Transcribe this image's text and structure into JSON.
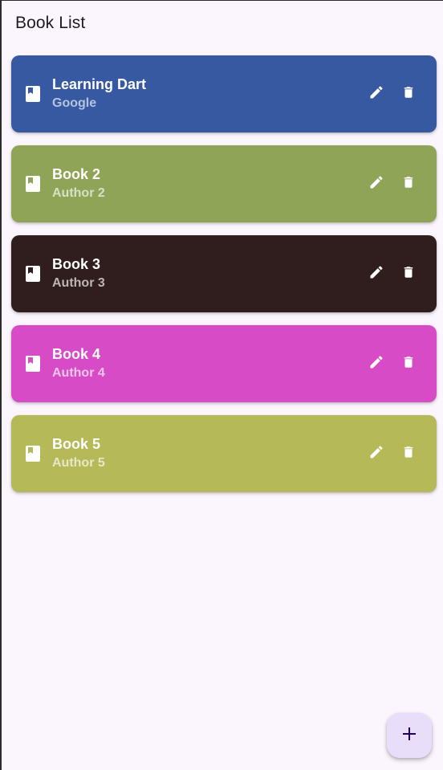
{
  "app_bar": {
    "title": "Book List"
  },
  "books": [
    {
      "title": "Learning Dart",
      "author": "Google",
      "color": "#3759a2",
      "author_color": "#b6c3e0"
    },
    {
      "title": "Book 2",
      "author": "Author 2",
      "color": "#8fa456",
      "author_color": "#d8e0c4"
    },
    {
      "title": "Book 3",
      "author": "Author 3",
      "color": "#301e1e",
      "author_color": "#bcb6b6"
    },
    {
      "title": "Book 4",
      "author": "Author 4",
      "color": "#d74cc6",
      "author_color": "#f1c5ec"
    },
    {
      "title": "Book 5",
      "author": "Author 5",
      "color": "#b5b957",
      "author_color": "#e6e8c6"
    }
  ],
  "icons": {
    "book": "book-icon",
    "edit": "edit-icon",
    "delete": "delete-icon",
    "add": "add-icon"
  },
  "fab": {
    "background": "#e9def9",
    "icon_color": "#21005d"
  }
}
